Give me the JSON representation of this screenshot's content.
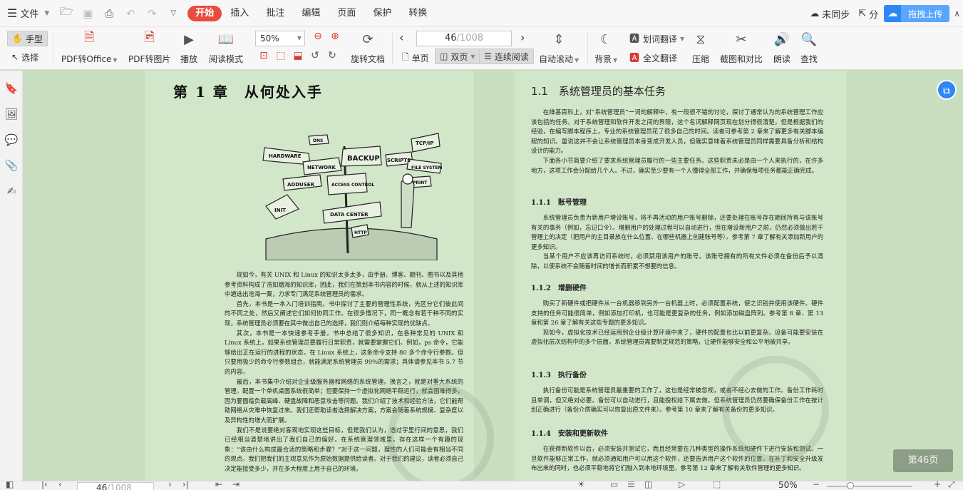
{
  "menubar": {
    "file_label": "文件",
    "tabs": [
      "开始",
      "插入",
      "批注",
      "编辑",
      "页面",
      "保护",
      "转换"
    ],
    "active_tab": "开始",
    "sync_label": "未同步",
    "share_label": "分",
    "upload_label": "拖拽上传"
  },
  "ribbon": {
    "hand_tool": "手型",
    "select_tool": "选择",
    "pdf_to_office": "PDF转Office",
    "pdf_to_image": "PDF转图片",
    "play": "播放",
    "read_mode": "阅读模式",
    "zoom_value": "50%",
    "rotate": "旋转文档",
    "page_current": "46",
    "page_total": "/1008",
    "single_page": "单页",
    "double_page": "双页",
    "continuous": "连续阅读",
    "auto_scroll": "自动滚动",
    "background": "背景",
    "word_translate": "划词翻译",
    "full_translate": "全文翻译",
    "compress": "压缩",
    "screenshot_compare": "截图和对比",
    "read_aloud": "朗读",
    "find": "查找"
  },
  "document": {
    "left_page": {
      "chapter_title": "第 1 章　从何处入手",
      "paragraphs": [
        "现如今，有关 UNIX 和 Linux 的知识太多太多，由手册、博客、期刊、图书以及其他参考资料构成了浩如烟海的知识库，因此，我们在策划本书内容的时候，就从上述的知识库中遴选出沧海一粟，力求专门满足系统管理员的需求。",
        "首先，本书是一本入门培训指南。书中探讨了主要的管理性系统，先区分它们彼此间的不同之处，然后又阐述它们如何协同工作。在很多情况下，同一概念有若干种不同的实现，系统管理员必须要在其中做出自己的选择，我们则介绍每种实现的优缺点。",
        "其次，本书是一本快速参考手册。书中总结了很多知识，在各种常见的 UNIX 和 Linux 系统上，如果系统管理员要履行日常职责，就需要掌握它们。例如，ps 命令，它能够给出正在运行的进程的状态。在 Linux 系统上，这条命令支持 80 多个命令行参数。但只要用极少的命令行参数组合，就能满足系统管理员 99%的需求；具体请参见本书 5.7 节的内容。",
        "最后，本书集中介绍对企业级服务器和网络的系统管理。换言之，就是对重大系统的管理。配置一个单机桌面系统很简单；但要保持一个虚拟化网络平稳运行，就会困难得多，因为要面临负载高峰、硬盘故障和恶意攻击等问题。我们介绍了技术和经验方法，它们能帮助网络从灾难中恢复过来。我们还帮助读者选择解决方案，方案会随着系统规模、复杂度以及异构性的增大而扩展。",
        "我们不是说要绝对客观地实现这些目标，但是我们认为，透过字里行间的意思，我们已经相当清楚地讲出了我们自己的偏好。在系统管理领域里，存在这样一个有趣的现象：“该由什么构成最合适的策略和步骤？”对于这一问题，理性的人们可能会有相当不同的观点。我们把我们的主观意见作为原始数据提供给读者。对于我们的建议，读者必须自己决定能接受多少，并在多大程度上用于自己的环境。"
      ],
      "sign_words": [
        "HARDWARE",
        "NETWORK",
        "BACKUP",
        "SCRIPTS",
        "TCP/IP",
        "FILE SYSTEM",
        "ADDUSER",
        "ACCESS CONTROL",
        "DATA CENTER",
        "PRINT",
        "INIT",
        "DNS",
        "HTTP"
      ]
    },
    "right_page": {
      "section_title": "1.1　系统管理员的基本任务",
      "intro": [
        "在维基百科上，对“系统管理员”一词的解释中，有一段很不错的讨论，探讨了通常认为的系统管理工作应该包括的任务。对于系统管理和软件开发之间的界限，这个名词解释网页现在划分得很清楚，但是根据我们的经验，在编写脚本程序上，专业的系统管理员花了很多自己的时间。读者可参考第 2 章来了解更多有关脚本编程的知识。虽说这并不会让系统管理员本身变成开发人员，但确实意味着系统管理员同样需要具备分析和结构设计的能力。",
        "下面各小节简要介绍了要求系统管理员履行的一些主要任务。这些职责未必是由一个人来执行的，在许多地方，这项工作会分配给几个人。不过，确实至少要有一个人懂得全部工作，并确保每项任务都能正确完成。"
      ],
      "sections": [
        {
          "title": "1.1.1　账号管理",
          "paragraphs": [
            "系统管理员负责为新用户增设账号，将不再活动的用户账号删除，还要处理在账号存在期间所有与该账号有关的事务（例如，忘记口令）。增删用户的处理过程可以自动进行，但在增设新用户之前，仍然必须做出若干管理上的决定（把用户的主目录放在什么位置、在哪些机器上创建账号等）。参考第 7 章了解有关添加新用户的更多知识。",
            "当某个用户不应该再访问系统时，必须禁用该用户的账号。该账号拥有的所有文件必须在备份后予以清除，以使系统不会随着时间的增长而积累不想要的信息。"
          ]
        },
        {
          "title": "1.1.2　增删硬件",
          "paragraphs": [
            "购买了新硬件或把硬件从一台机器移到另外一台机器上时，必须配置系统，使之识别并使用该硬件。硬件支持的任务可能很简单，例如添加打印机，也可能是更复杂的任务，例如添加磁盘阵列。参考第 8 章、第 13 章和第 26 章了解有关这些专题的更多知识。",
            "现如今，虚拟化技术已经运用到企业级计算环境中来了，硬件的配置也比以前更复杂。设备可能要安装在虚拟化层次结构中的多个层面。系统管理员需要制定规范的策略，让硬件能够安全和公平地被共享。"
          ]
        },
        {
          "title": "1.1.3　执行备份",
          "paragraphs": [
            "执行备份可能是系统管理员最重要的工作了，这也是经常被忽视，或者不经心去做的工作。备份工作耗时且单调，但又绝对必要。备份可以自动进行，且能授权给下属去做，但系统管理员仍然要确保备份工作在按计划正确进行（备份介质确实可以恢复出原文件来）。参考第 10 章来了解有关备份的更多知识。"
          ]
        },
        {
          "title": "1.1.4　安装和更新软件",
          "paragraphs": [
            "在获得新软件以后，必须安装并测试它，而且经常要在几种类型的操作系统和硬件下进行安装和测试。一旦软件能够正常工作，就必须通知用户可以用这个软件，还要告诉用户这个软件的位置。在补丁和安全升级发布出来的同时，也必须平稳地将它们融入到本地环境里。参考第 12 章来了解有关软件管理的更多知识。"
          ]
        }
      ]
    },
    "page_badge": "第46页"
  },
  "statusbar": {
    "page_current": "46",
    "page_total": "/1008",
    "zoom": "50%"
  },
  "colors": {
    "accent": "#e94c3e",
    "page_bg": "#d2e6c9",
    "canvas_bg": "#c9dfc0",
    "upload_blue": "#5aa6ff"
  }
}
